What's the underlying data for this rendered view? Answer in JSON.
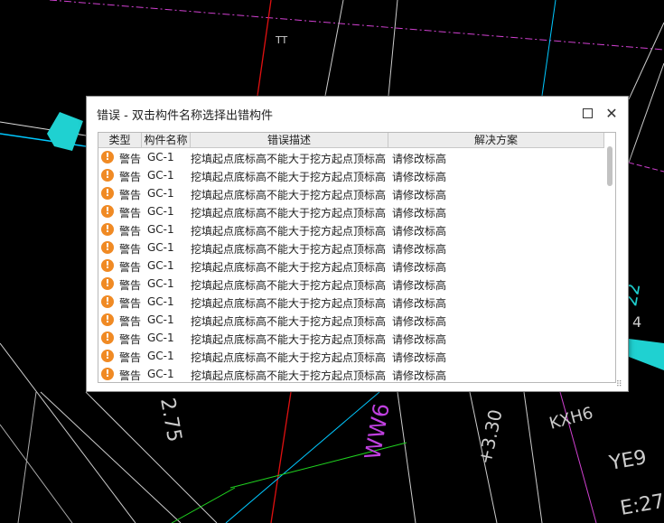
{
  "cad_labels": {
    "label_tt": "TT",
    "label_275": "2.75",
    "label_ww6": "WW6",
    "label_330": "+3.30",
    "label_ye9": "YE9",
    "label_e27": "E:27",
    "label_kxh": "KXH6",
    "label_22": "22",
    "label_4": "4"
  },
  "colors": {
    "warning": "#f08a24",
    "header_bg": "#ececec"
  },
  "dialog": {
    "title": "错误 - 双击构件名称选择出错构件",
    "columns": [
      "类型",
      "构件名称",
      "错误描述",
      "解决方案"
    ],
    "rows": [
      {
        "type": "警告",
        "name": "GC-1",
        "description": "挖填起点底标高不能大于挖方起点顶标高",
        "solution": "请修改标高"
      },
      {
        "type": "警告",
        "name": "GC-1",
        "description": "挖填起点底标高不能大于挖方起点顶标高",
        "solution": "请修改标高"
      },
      {
        "type": "警告",
        "name": "GC-1",
        "description": "挖填起点底标高不能大于挖方起点顶标高",
        "solution": "请修改标高"
      },
      {
        "type": "警告",
        "name": "GC-1",
        "description": "挖填起点底标高不能大于挖方起点顶标高",
        "solution": "请修改标高"
      },
      {
        "type": "警告",
        "name": "GC-1",
        "description": "挖填起点底标高不能大于挖方起点顶标高",
        "solution": "请修改标高"
      },
      {
        "type": "警告",
        "name": "GC-1",
        "description": "挖填起点底标高不能大于挖方起点顶标高",
        "solution": "请修改标高"
      },
      {
        "type": "警告",
        "name": "GC-1",
        "description": "挖填起点底标高不能大于挖方起点顶标高",
        "solution": "请修改标高"
      },
      {
        "type": "警告",
        "name": "GC-1",
        "description": "挖填起点底标高不能大于挖方起点顶标高",
        "solution": "请修改标高"
      },
      {
        "type": "警告",
        "name": "GC-1",
        "description": "挖填起点底标高不能大于挖方起点顶标高",
        "solution": "请修改标高"
      },
      {
        "type": "警告",
        "name": "GC-1",
        "description": "挖填起点底标高不能大于挖方起点顶标高",
        "solution": "请修改标高"
      },
      {
        "type": "警告",
        "name": "GC-1",
        "description": "挖填起点底标高不能大于挖方起点顶标高",
        "solution": "请修改标高"
      },
      {
        "type": "警告",
        "name": "GC-1",
        "description": "挖填起点底标高不能大于挖方起点顶标高",
        "solution": "请修改标高"
      },
      {
        "type": "警告",
        "name": "GC-1",
        "description": "挖填起点底标高不能大于挖方起点顶标高",
        "solution": "请修改标高"
      }
    ]
  },
  "icons": {
    "warning": "warning-icon",
    "maximize": "maximize-icon",
    "close": "close-icon",
    "resize": "resize-grip-icon"
  }
}
